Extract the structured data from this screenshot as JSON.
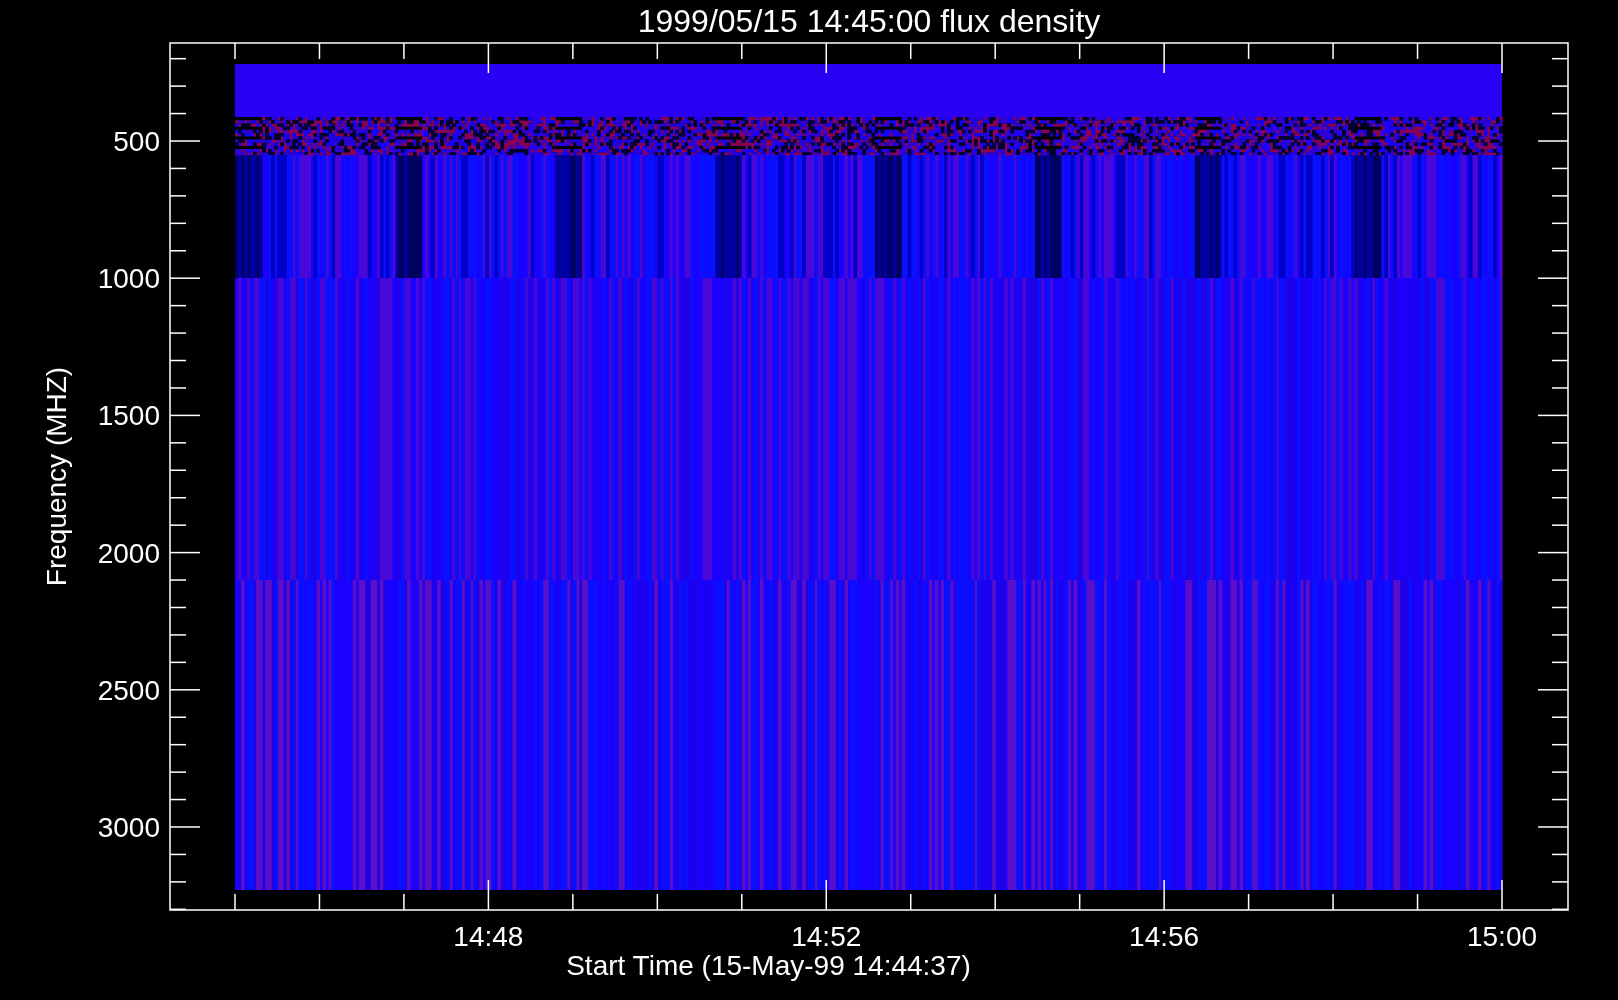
{
  "title": "1999/05/15 14:45:00 flux density",
  "y_axis": {
    "label": "Frequency (MHZ)",
    "ticks": [
      "500",
      "1000",
      "1500",
      "2000",
      "2500",
      "3000"
    ]
  },
  "x_axis": {
    "label": "Start Time (15-May-99 14:44:37)",
    "ticks": [
      "14:48",
      "14:52",
      "14:56",
      "15:00"
    ]
  }
}
